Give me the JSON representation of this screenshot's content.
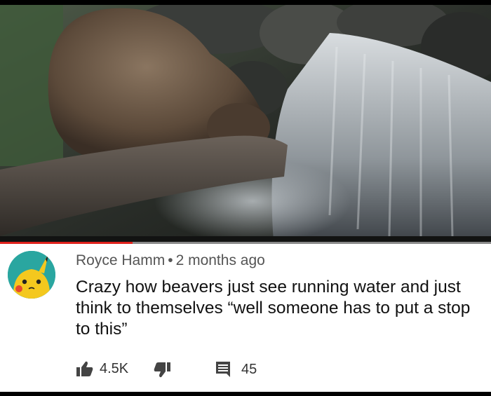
{
  "video": {
    "progress": 0.27,
    "colors": {
      "played": "#e0221c",
      "track": "#8a8a8a"
    }
  },
  "comment": {
    "author": "Royce Hamm",
    "separator": "•",
    "time": "2 months ago",
    "text": "Crazy how beavers just see running water and just think to themselves “well someone has to put a stop to this”",
    "likes": "4.5K",
    "replies": "45",
    "icons": {
      "like": "thumbs-up-icon",
      "dislike": "thumbs-down-icon",
      "reply": "comment-icon"
    }
  }
}
